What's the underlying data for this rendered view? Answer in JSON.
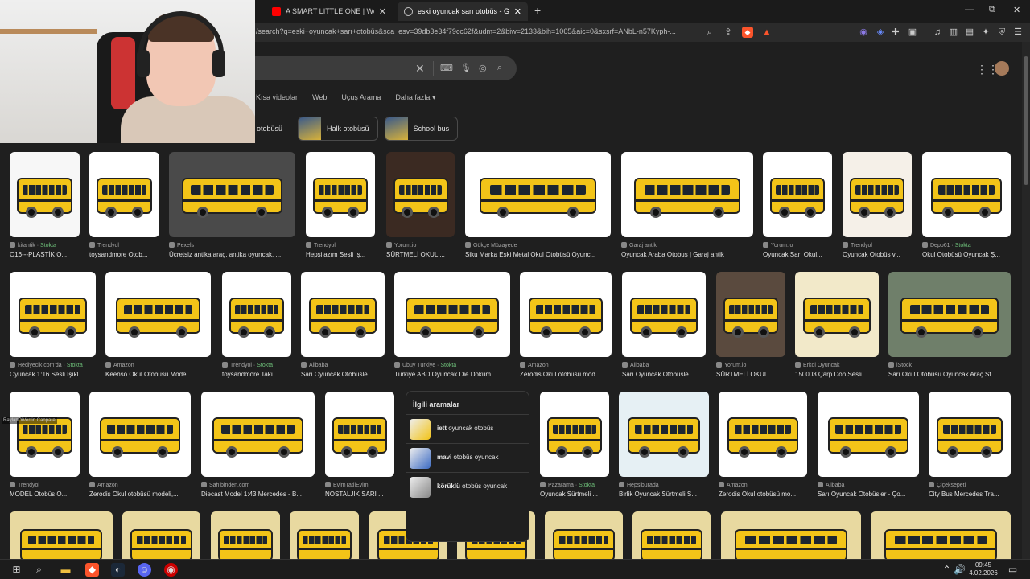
{
  "browser": {
    "tabs": [
      {
        "title": "A SMART LITTLE ONE | We Got Mad",
        "active": false
      },
      {
        "title": "eski oyuncak sarı otobüs - Goog",
        "active": true
      }
    ],
    "url": "/search?q=eski+oyuncak+sarı+otobüs&sca_esv=39db3e34f79cc62f&udm=2&biw=2133&bih=1065&aic=0&sxsrf=ANbL-n57Kyph-...",
    "window_controls": {
      "minimize": "—",
      "maximize": "⧉",
      "close": "✕"
    },
    "new_tab": "+"
  },
  "search": {
    "clear": "✕"
  },
  "nav_tabs": [
    "Kısa videolar",
    "Web",
    "Uçuş Arama",
    "Daha fazla"
  ],
  "chips": [
    "otobüsü",
    "Halk otobüsü",
    "School bus"
  ],
  "results": [
    {
      "source": "kitantik",
      "stock": "Stokta",
      "caption": "O16---PLASTİK O..."
    },
    {
      "source": "Trendyol",
      "stock": "",
      "caption": "toysandmore Otob..."
    },
    {
      "source": "Pexels",
      "stock": "",
      "caption": "Ücretsiz antika araç, antika oyuncak, ..."
    },
    {
      "source": "Trendyol",
      "stock": "",
      "caption": "Hepsilazım Sesli İş..."
    },
    {
      "source": "Yorum.io",
      "stock": "",
      "caption": "SÜRTMELİ OKUL ..."
    },
    {
      "source": "Gökçe Müzayede",
      "stock": "",
      "caption": "Siku Marka Eski Metal Okul Otobüsü Oyunc..."
    },
    {
      "source": "Garaj antik",
      "stock": "",
      "caption": "Oyuncak Araba Otobus | Garaj antik"
    },
    {
      "source": "Yorum.io",
      "stock": "",
      "caption": "Oyuncak Sarı Okul..."
    },
    {
      "source": "Trendyol",
      "stock": "",
      "caption": "Oyuncak Otobüs v..."
    },
    {
      "source": "Depo61",
      "stock": "Stokta",
      "caption": "Okul Otobüsü Oyuncak Ş..."
    },
    {
      "source": "Hediyecik.com'da",
      "stock": "Stokta",
      "caption": "Oyuncak 1:16 Sesli Işıkl..."
    },
    {
      "source": "Amazon",
      "stock": "",
      "caption": "Keenso Okul Otobüsü Model ..."
    },
    {
      "source": "Trendyol",
      "stock": "Stokta",
      "caption": "toysandmore Takı..."
    },
    {
      "source": "Alibaba",
      "stock": "",
      "caption": "Sarı Oyuncak Otobüsle..."
    },
    {
      "source": "Ubuy Türkiye",
      "stock": "Stokta",
      "caption": "Türkiye ABD Oyuncak Die Döküm..."
    },
    {
      "source": "Amazon",
      "stock": "",
      "caption": "Zerodis Okul otobüsü mod..."
    },
    {
      "source": "Alibaba",
      "stock": "",
      "caption": "Sarı Oyuncak Otobüsle..."
    },
    {
      "source": "Yorum.io",
      "stock": "",
      "caption": "SÜRTMELİ OKUL ..."
    },
    {
      "source": "Erkol Oyuncak",
      "stock": "",
      "caption": "150003 Çarp Dön Sesli..."
    },
    {
      "source": "iStock",
      "stock": "",
      "caption": "Sarı Okul Otobüsü Oyuncak Araç St..."
    },
    {
      "source": "Trendyol",
      "stock": "",
      "caption": "MODEL Otobüs O..."
    },
    {
      "source": "Amazon",
      "stock": "",
      "caption": "Zerodis Okul otobüsü modeli,..."
    },
    {
      "source": "Sahibinden.com",
      "stock": "",
      "caption": "Diecast Model 1:43 Mercedes - B..."
    },
    {
      "source": "EvimTatliEvim",
      "stock": "",
      "caption": "NOSTALJİK SARI ..."
    },
    {
      "source": "Pazarama",
      "stock": "Stokta",
      "caption": "Oyuncak Sürtmeli ..."
    },
    {
      "source": "Hepsiburada",
      "stock": "",
      "caption": "Birlik Oyuncak Sürtmeli S..."
    },
    {
      "source": "Amazon",
      "stock": "",
      "caption": "Zerodis Okul otobüsü mo..."
    },
    {
      "source": "Alibaba",
      "stock": "",
      "caption": "Sarı Oyuncak Otobüsler - Ço..."
    },
    {
      "source": "Çiçeksepeti",
      "stock": "",
      "caption": "City Bus Mercedes Tra..."
    }
  ],
  "related": {
    "title": "İlgili aramalar",
    "items": [
      {
        "bold": "iett",
        "rest": " oyuncak otobüs"
      },
      {
        "bold": "mavi",
        "rest": " otobüs oyuncak"
      },
      {
        "bold": "körüklü",
        "rest": " otobüs oyuncak"
      }
    ]
  },
  "overlay_label": "RaylanDiVerrin Canpare",
  "taskbar": {
    "time": "09:45",
    "date": "4.02.2026"
  },
  "colors": {
    "page_bg": "#1f1f1f",
    "bus_yellow": "#f3c418",
    "stock_green": "#6ec07a"
  }
}
